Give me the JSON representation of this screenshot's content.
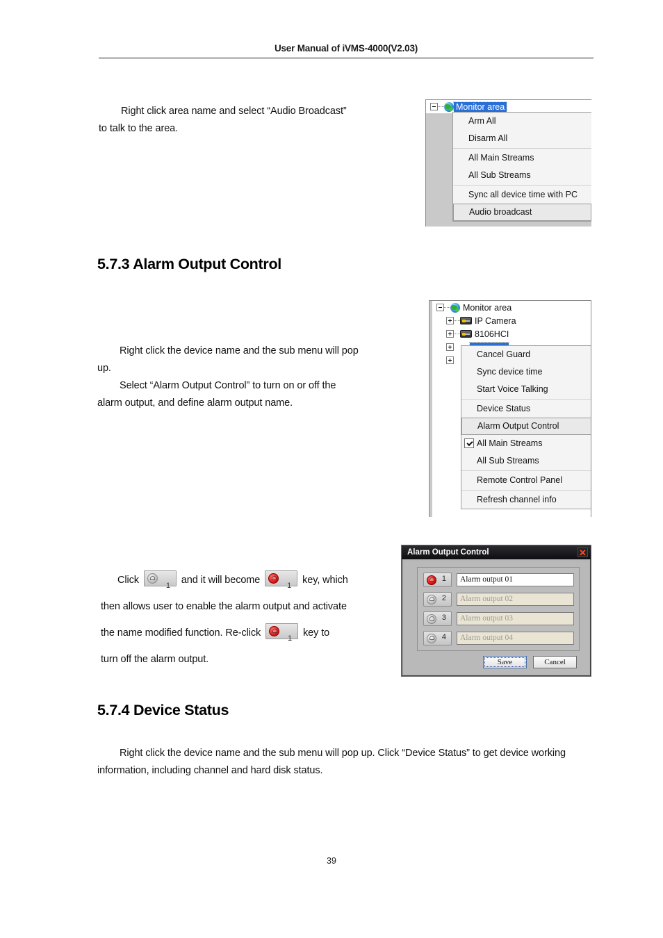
{
  "header": {
    "title": "User Manual of iVMS-4000(V2.03)"
  },
  "page_number": "39",
  "paragraphs": {
    "audio_broadcast_line1": "Right click area name and select “Audio Broadcast”",
    "audio_broadcast_line2": "to talk to the area.",
    "alarm_line1": "Right click the device name and the sub menu will pop",
    "alarm_line2": "up.",
    "alarm_line3": "Select “Alarm Output Control” to turn on or off the",
    "alarm_line4": "alarm output, and define alarm output name.",
    "key_pre": "Click",
    "key_mid": "and it will become",
    "key_post": "key, which",
    "key_line2": "then allows user to enable the alarm output and activate",
    "key_line3a": "the name modified function. Re-click",
    "key_line3b": "key to",
    "key_line4": "turn off the alarm output.",
    "device_status_line1": "Right click the device name and the sub menu will pop up. Click “Device Status” to get device working",
    "device_status_line2": "information, including channel and hard disk status."
  },
  "sections": {
    "alarm_output_control": "5.7.3 Alarm Output Control",
    "device_status": "5.7.4 Device Status"
  },
  "inline_keys": {
    "off_key_number": "1",
    "on_key_number": "1",
    "reclick_key_number": "1"
  },
  "screenshot_area_menu": {
    "tree": {
      "root_label": "Monitor area",
      "root_icon": "globe-icon",
      "root_selected": true
    },
    "menu_items": [
      {
        "label": "Arm All",
        "separator_after": false,
        "hover": false,
        "checked": false
      },
      {
        "label": "Disarm All",
        "separator_after": true,
        "hover": false,
        "checked": false
      },
      {
        "label": "All Main Streams",
        "separator_after": false,
        "hover": false,
        "checked": false
      },
      {
        "label": "All Sub Streams",
        "separator_after": true,
        "hover": false,
        "checked": false
      },
      {
        "label": "Sync all device time with PC",
        "separator_after": false,
        "hover": false,
        "checked": false
      },
      {
        "label": "Audio broadcast",
        "separator_after": false,
        "hover": true,
        "checked": false
      }
    ]
  },
  "screenshot_device_menu": {
    "tree": [
      {
        "label": "Monitor area",
        "icon": "globe-icon",
        "level": 1,
        "expander": "minus"
      },
      {
        "label": "IP Camera",
        "icon": "device-icon",
        "level": 2,
        "expander": "plus"
      },
      {
        "label": "8106HCI",
        "icon": "device-icon",
        "level": 2,
        "expander": "plus"
      }
    ],
    "menu_items": [
      {
        "label": "Cancel Guard",
        "separator_after": false,
        "hover": false,
        "checked": false
      },
      {
        "label": "Sync device time",
        "separator_after": false,
        "hover": false,
        "checked": false
      },
      {
        "label": "Start Voice Talking",
        "separator_after": true,
        "hover": false,
        "checked": false
      },
      {
        "label": "Device Status",
        "separator_after": false,
        "hover": false,
        "checked": false
      },
      {
        "label": "Alarm Output Control",
        "separator_after": true,
        "hover": true,
        "checked": false
      },
      {
        "label": "All Main Streams",
        "separator_after": false,
        "hover": false,
        "checked": true
      },
      {
        "label": "All Sub Streams",
        "separator_after": true,
        "hover": false,
        "checked": false
      },
      {
        "label": "Remote Control Panel",
        "separator_after": true,
        "hover": false,
        "checked": false
      },
      {
        "label": "Refresh channel info",
        "separator_after": false,
        "hover": false,
        "checked": false
      }
    ]
  },
  "dialog": {
    "title": "Alarm Output Control",
    "close_icon": "✕",
    "rows": [
      {
        "number": "1",
        "value": "Alarm output 01",
        "state": "on"
      },
      {
        "number": "2",
        "value": "Alarm output 02",
        "state": "off"
      },
      {
        "number": "3",
        "value": "Alarm output 03",
        "state": "off"
      },
      {
        "number": "4",
        "value": "Alarm output 04",
        "state": "off"
      }
    ],
    "save_label": "Save",
    "cancel_label": "Cancel"
  },
  "colors": {
    "selection_blue": "#2a6fd6",
    "alarm_red": "#e41010",
    "close_orange": "#ff4d1a",
    "title_dark": "#0e0e12"
  }
}
